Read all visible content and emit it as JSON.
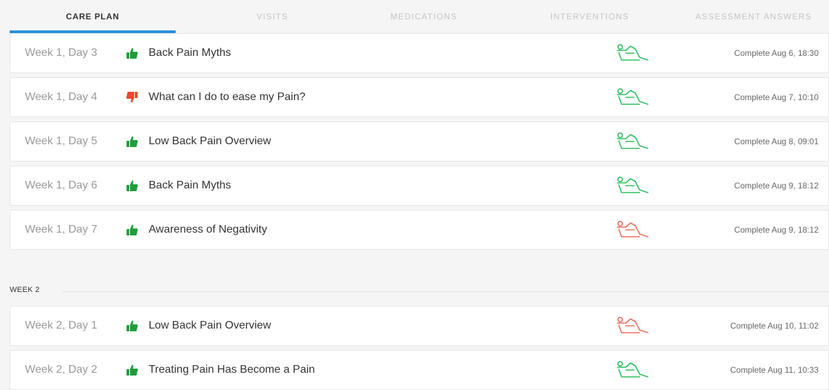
{
  "tabs": [
    {
      "label": "CARE PLAN"
    },
    {
      "label": "VISITS"
    },
    {
      "label": "MEDICATIONS"
    },
    {
      "label": "INTERVENTIONS"
    },
    {
      "label": "ASSESSMENT ANSWERS"
    }
  ],
  "colors": {
    "accent": "#2a8fdc",
    "thumb_up": "#1e9e3a",
    "thumb_down": "#e5492e",
    "person_ok": "#2bbf5e",
    "person_warn": "#f06a5a"
  },
  "week1": {
    "items": [
      {
        "day": "Week 1, Day 3",
        "feedback": "thumbs-up",
        "title": "Back Pain Myths",
        "pain_icon_state": "green",
        "status": "Complete Aug 6, 18:30"
      },
      {
        "day": "Week 1, Day 4",
        "feedback": "thumbs-down",
        "title": "What can I do to ease my Pain?",
        "pain_icon_state": "green",
        "status": "Complete Aug 7, 10:10"
      },
      {
        "day": "Week 1, Day 5",
        "feedback": "thumbs-up",
        "title": "Low Back Pain Overview",
        "pain_icon_state": "green",
        "status": "Complete Aug 8, 09:01"
      },
      {
        "day": "Week 1, Day 6",
        "feedback": "thumbs-up",
        "title": "Back Pain Myths",
        "pain_icon_state": "green",
        "status": "Complete Aug 9, 18:12"
      },
      {
        "day": "Week 1, Day 7",
        "feedback": "thumbs-up",
        "title": "Awareness of Negativity",
        "pain_icon_state": "red",
        "status": "Complete Aug 9, 18:12"
      }
    ]
  },
  "week2": {
    "label": "WEEK 2",
    "items": [
      {
        "day": "Week 2, Day 1",
        "feedback": "thumbs-up",
        "title": "Low Back Pain Overview",
        "pain_icon_state": "red",
        "status": "Complete Aug 10, 11:02"
      },
      {
        "day": "Week 2, Day 2",
        "feedback": "thumbs-up",
        "title": "Treating Pain Has Become a Pain",
        "pain_icon_state": "green",
        "status": "Complete Aug 11, 10:33"
      }
    ]
  }
}
